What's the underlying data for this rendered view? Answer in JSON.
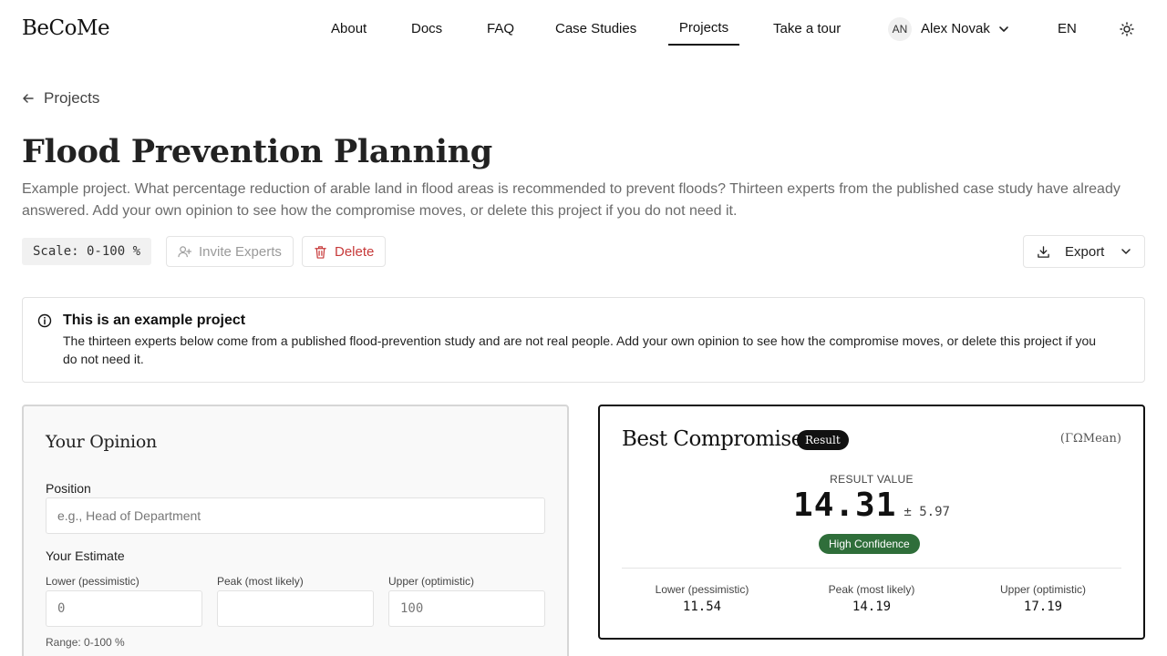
{
  "header": {
    "logo": "BeCoMe",
    "nav": [
      {
        "label": "About"
      },
      {
        "label": "Docs"
      },
      {
        "label": "FAQ"
      },
      {
        "label": "Case Studies"
      },
      {
        "label": "Projects",
        "active": true
      },
      {
        "label": "Take a tour"
      }
    ],
    "user": {
      "initials": "AN",
      "name": "Alex Novak"
    },
    "language": "EN",
    "theme_icon": "sun-icon"
  },
  "back_link": {
    "label": "Projects",
    "icon": "arrow-left-icon"
  },
  "project": {
    "title": "Flood Prevention Planning",
    "description": "Example project. What percentage reduction of arable land in flood areas is recommended to prevent floods? Thirteen experts from the published case study have already answered. Add your own opinion to see how the compromise moves, or delete this project if you do not need it."
  },
  "toolbar": {
    "scale": "Scale: 0-100 %",
    "invite_label": "Invite Experts",
    "delete_label": "Delete",
    "export_label": "Export"
  },
  "notice": {
    "title": "This is an example project",
    "text": "The thirteen experts below come from a published flood-prevention study and are not real people. Add your own opinion to see how the compromise moves, or delete this project if you do not need it."
  },
  "opinion": {
    "title": "Your Opinion",
    "position_label": "Position",
    "position_placeholder": "e.g., Head of Department",
    "estimate_label": "Your Estimate",
    "lower_label": "Lower (pessimistic)",
    "peak_label": "Peak (most likely)",
    "upper_label": "Upper (optimistic)",
    "lower_placeholder": "0",
    "peak_placeholder": "",
    "upper_placeholder": "100",
    "range_text": "Range: 0-100 %"
  },
  "result": {
    "title": "Best Compromise",
    "badge": "Result",
    "method": "(ΓΩMean)",
    "caption": "RESULT VALUE",
    "value": "14.31",
    "error": "± 5.97",
    "confidence": "High Confidence",
    "lower_label": "Lower (pessimistic)",
    "lower_value": "11.54",
    "peak_label": "Peak (most likely)",
    "peak_value": "14.19",
    "upper_label": "Upper (optimistic)",
    "upper_value": "17.19"
  }
}
